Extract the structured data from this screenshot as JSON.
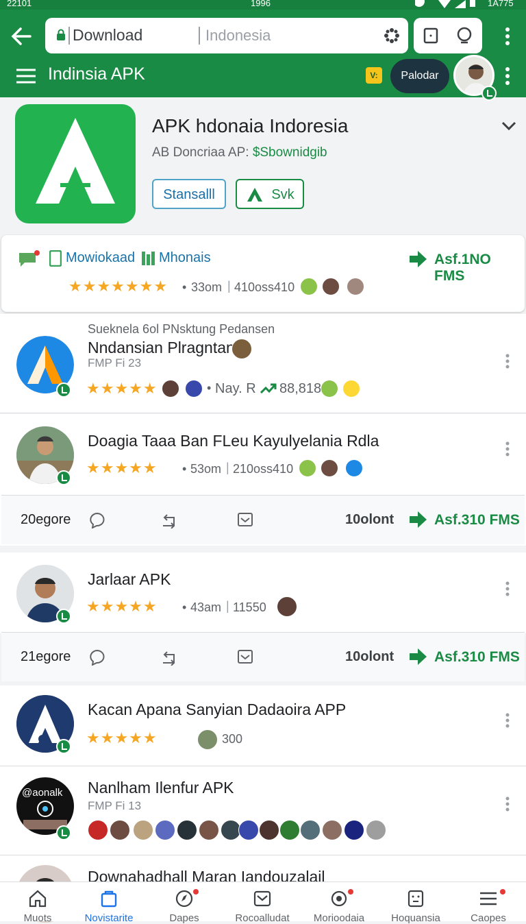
{
  "status": {
    "left": "22101",
    "center": "1996",
    "right": "1A775"
  },
  "browser": {
    "url_main": "Download",
    "url_sub": "Indonesia"
  },
  "appbar": {
    "title": "Indinsia APK",
    "pill_label": "Palodar",
    "bolt_text": "V:"
  },
  "app": {
    "name": "APK hdonaia Indoresia",
    "subtitle_prefix": "AB Doncriaa AP:",
    "subtitle_link": "$Sbownidgib",
    "install_label": "Stansalll",
    "secondary_label": "Svk"
  },
  "summary": {
    "tab1": "Mowiokaad",
    "tab2": "Mhonais",
    "action": "Asf.1NO FMS",
    "meta1": "33om",
    "meta2": "410oss410"
  },
  "items": [
    {
      "overline": "Sueknela 6ol PNsktung Pedansen",
      "title": "Nndansian Plragntan",
      "sub": "FMP Fi 23",
      "meta1": "Nay. R",
      "meta2": "88,818"
    },
    {
      "title": "Doagia Taaa Ban FLeu Kayulyelania Rdla",
      "meta1": "53om",
      "meta2": "210oss410"
    },
    {
      "title": "Jarlaar APK",
      "meta1": "43am",
      "meta2": "11550"
    },
    {
      "title": "Kacan Apana Sanyian Dadaoira APP",
      "meta1": "300"
    },
    {
      "title": "Nanlham Ilenfur APK",
      "sub": "FMP Fi 13",
      "avatar_text": "@aonalk"
    },
    {
      "title": "Downahadhall Maran Iandouzalail"
    }
  ],
  "action_rows": [
    {
      "left": "20egore",
      "count": "10olont",
      "action": "Asf.310 FMS"
    },
    {
      "left": "21egore",
      "count": "10olont",
      "action": "Asf.310 FMS"
    }
  ],
  "nav": [
    {
      "label": "Muots",
      "icon": "home-icon"
    },
    {
      "label": "Novistarite",
      "icon": "bag-icon"
    },
    {
      "label": "Dapes",
      "icon": "compass-icon"
    },
    {
      "label": "Rocoalludat",
      "icon": "mail-icon"
    },
    {
      "label": "Morioodaia",
      "icon": "settings-icon"
    },
    {
      "label": "Hoquansia",
      "icon": "face-icon"
    },
    {
      "label": "Caopes",
      "icon": "menu-icon"
    }
  ],
  "colors": {
    "brand": "#1a8b45",
    "star": "#f5a623",
    "active": "#1a73e8"
  }
}
